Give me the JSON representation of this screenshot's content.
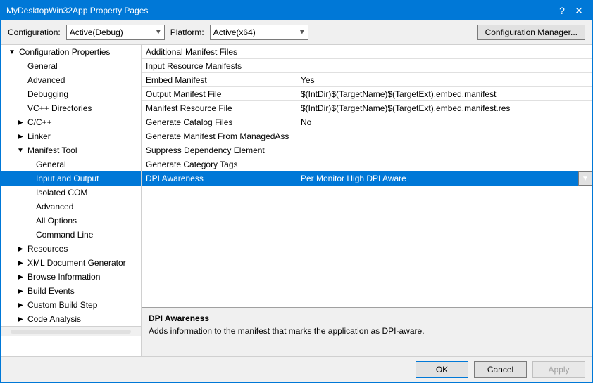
{
  "window": {
    "title": "MyDesktopWin32App Property Pages",
    "close_label": "✕",
    "help_label": "?"
  },
  "config_row": {
    "config_label": "Configuration:",
    "config_value": "Active(Debug)",
    "platform_label": "Platform:",
    "platform_value": "Active(x64)",
    "manager_btn": "Configuration Manager..."
  },
  "tree": {
    "items": [
      {
        "id": "config-props",
        "label": "Configuration Properties",
        "indent": "indent-1",
        "toggle": "expanded",
        "level": 0
      },
      {
        "id": "general",
        "label": "General",
        "indent": "indent-2",
        "toggle": "leaf",
        "level": 1
      },
      {
        "id": "advanced",
        "label": "Advanced",
        "indent": "indent-2",
        "toggle": "leaf",
        "level": 1
      },
      {
        "id": "debugging",
        "label": "Debugging",
        "indent": "indent-2",
        "toggle": "leaf",
        "level": 1
      },
      {
        "id": "vc-dirs",
        "label": "VC++ Directories",
        "indent": "indent-2",
        "toggle": "leaf",
        "level": 1
      },
      {
        "id": "cpp",
        "label": "C/C++",
        "indent": "indent-2",
        "toggle": "collapsed",
        "level": 1
      },
      {
        "id": "linker",
        "label": "Linker",
        "indent": "indent-2",
        "toggle": "collapsed",
        "level": 1
      },
      {
        "id": "manifest-tool",
        "label": "Manifest Tool",
        "indent": "indent-2",
        "toggle": "expanded",
        "level": 1
      },
      {
        "id": "mt-general",
        "label": "General",
        "indent": "indent-3",
        "toggle": "leaf",
        "level": 2
      },
      {
        "id": "input-output",
        "label": "Input and Output",
        "indent": "indent-3",
        "toggle": "leaf",
        "level": 2,
        "selected": true
      },
      {
        "id": "isolated-com",
        "label": "Isolated COM",
        "indent": "indent-3",
        "toggle": "leaf",
        "level": 2
      },
      {
        "id": "mt-advanced",
        "label": "Advanced",
        "indent": "indent-3",
        "toggle": "leaf",
        "level": 2
      },
      {
        "id": "all-options",
        "label": "All Options",
        "indent": "indent-3",
        "toggle": "leaf",
        "level": 2
      },
      {
        "id": "command-line",
        "label": "Command Line",
        "indent": "indent-3",
        "toggle": "leaf",
        "level": 2
      },
      {
        "id": "resources",
        "label": "Resources",
        "indent": "indent-2",
        "toggle": "collapsed",
        "level": 1
      },
      {
        "id": "xml-doc",
        "label": "XML Document Generator",
        "indent": "indent-2",
        "toggle": "collapsed",
        "level": 1
      },
      {
        "id": "browse-info",
        "label": "Browse Information",
        "indent": "indent-2",
        "toggle": "collapsed",
        "level": 1
      },
      {
        "id": "build-events",
        "label": "Build Events",
        "indent": "indent-2",
        "toggle": "collapsed",
        "level": 1
      },
      {
        "id": "custom-build",
        "label": "Custom Build Step",
        "indent": "indent-2",
        "toggle": "collapsed",
        "level": 1
      },
      {
        "id": "code-analysis",
        "label": "Code Analysis",
        "indent": "indent-2",
        "toggle": "collapsed",
        "level": 1
      }
    ]
  },
  "properties": {
    "rows": [
      {
        "id": "additional-manifest",
        "name": "Additional Manifest Files",
        "value": "",
        "selected": false
      },
      {
        "id": "input-resource",
        "name": "Input Resource Manifests",
        "value": "",
        "selected": false
      },
      {
        "id": "embed-manifest",
        "name": "Embed Manifest",
        "value": "Yes",
        "selected": false
      },
      {
        "id": "output-manifest",
        "name": "Output Manifest File",
        "value": "$(IntDir)$(TargetName)$(TargetExt).embed.manifest",
        "selected": false
      },
      {
        "id": "manifest-resource",
        "name": "Manifest Resource File",
        "value": "$(IntDir)$(TargetName)$(TargetExt).embed.manifest.res",
        "selected": false
      },
      {
        "id": "generate-catalog",
        "name": "Generate Catalog Files",
        "value": "No",
        "selected": false
      },
      {
        "id": "generate-managed",
        "name": "Generate Manifest From ManagedAss",
        "value": "",
        "selected": false
      },
      {
        "id": "suppress-dep",
        "name": "Suppress Dependency Element",
        "value": "",
        "selected": false
      },
      {
        "id": "generate-category",
        "name": "Generate Category Tags",
        "value": "",
        "selected": false
      },
      {
        "id": "dpi-awareness",
        "name": "DPI Awareness",
        "value": "Per Monitor High DPI Aware",
        "selected": true,
        "has_dropdown": true
      }
    ]
  },
  "description": {
    "title": "DPI Awareness",
    "text": "Adds information to the manifest that marks the application as DPI-aware."
  },
  "buttons": {
    "ok": "OK",
    "cancel": "Cancel",
    "apply": "Apply"
  }
}
